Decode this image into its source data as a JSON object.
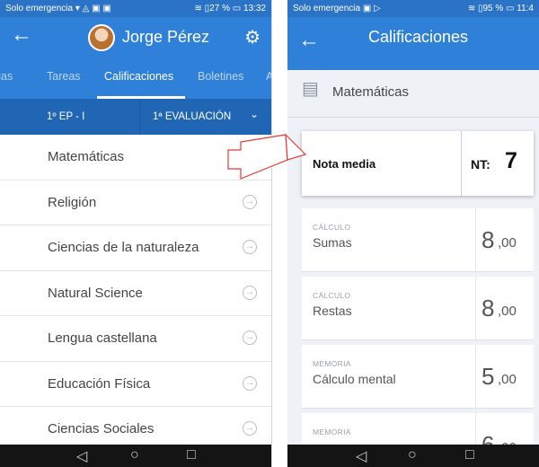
{
  "left": {
    "status_left": "Solo emergencia ▾ ◬ ▣ ▣",
    "status_right": "≋ ▯27 % ▭ 13:32",
    "back_icon": "←",
    "person_name": "Jorge Pérez",
    "settings_icon": "⚙",
    "tabs": [
      "cias",
      "Tareas",
      "Calificaciones",
      "Boletines",
      "A"
    ],
    "course": "1º EP - I",
    "evaluation": "1ª EVALUACIÓN",
    "chevron": "⌄",
    "subjects": [
      "Matemáticas",
      "Religión",
      "Ciencias de la naturaleza",
      "Natural Science",
      "Lengua castellana",
      "Educación Física",
      "Ciencias Sociales"
    ],
    "go_icon": "→",
    "nav": [
      "◁",
      "○",
      "□"
    ]
  },
  "right": {
    "status_left": "Solo emergencia ▣ ▷",
    "status_right": "≋ ▯95 % ▭ 11:4",
    "back_icon": "←",
    "title": "Calificaciones",
    "subject_icon": "▤",
    "subject_name": "Matemáticas",
    "avg_label": "Nota media",
    "avg_prefix": "NT:",
    "avg_value": "7",
    "grades": [
      {
        "category": "CÁLCULO",
        "name": "Sumas",
        "int": "8",
        "dec": ",00"
      },
      {
        "category": "CÁLCULO",
        "name": "Restas",
        "int": "8",
        "dec": ",00"
      },
      {
        "category": "MEMORIA",
        "name": "Cálculo mental",
        "int": "5",
        "dec": ",00"
      },
      {
        "category": "MEMORIA",
        "name": "",
        "int": "6",
        "dec": ",00"
      }
    ],
    "nav": [
      "◁",
      "○",
      "□"
    ]
  },
  "colors": {
    "primary": "#2f80d8",
    "primary_dark": "#2166b5",
    "arrow": "#e53935"
  }
}
